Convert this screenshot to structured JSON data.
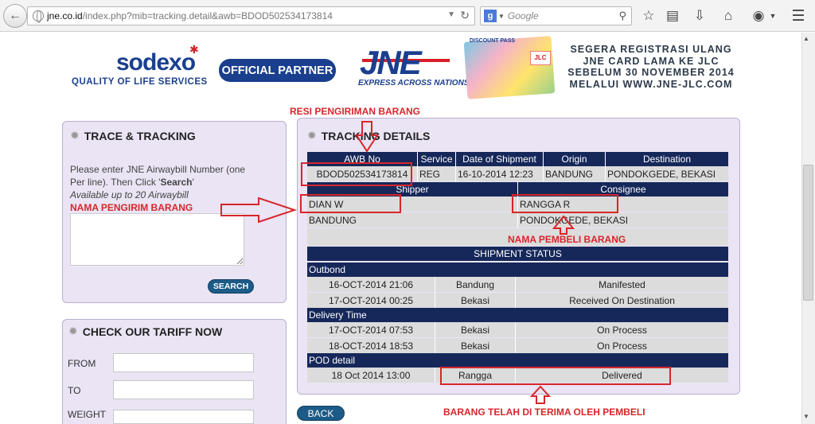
{
  "browser": {
    "url_host": "jne.co.id",
    "url_path": "/index.php?mib=tracking.detail&awb=BDOD502534173814",
    "search_placeholder": "Google",
    "search_engine_icon": "g"
  },
  "banner": {
    "sodexo": "sodexo",
    "sodexo_tagline": "QUALITY OF LIFE SERVICES",
    "official_partner": "OFFICIAL PARTNER",
    "jne_logo": "JNE",
    "jne_tagline": "EXPRESS ACROSS NATIONS",
    "card_label": "DISCOUNT PASS",
    "card_badge": "JLC",
    "promo_lines": [
      "SEGERA REGISTRASI ULANG",
      "JNE CARD LAMA KE JLC",
      "SEBELUM 30 NOVEMBER 2014",
      "MELALUI WWW.JNE-JLC.COM"
    ]
  },
  "trace": {
    "title": "TRACE & TRACKING",
    "help_line1": "Please enter JNE Airwaybill Number (one",
    "help_line2_pre": "Per line). Then Click '",
    "help_line2_bold": "Search",
    "help_line2_post": "'",
    "help_line3": "Available up to 20 Airwaybill",
    "search_button": "SEARCH"
  },
  "tariff": {
    "title": "CHECK OUR TARIFF NOW",
    "from_label": "FROM",
    "to_label": "TO",
    "weight_label": "WEIGHT"
  },
  "details": {
    "title": "TRACKING DETAILS",
    "headers": {
      "awb": "AWB No",
      "service": "Service",
      "date": "Date of Shipment",
      "origin": "Origin",
      "destination": "Destination"
    },
    "awb_no": "BDOD502534173814",
    "service": "REG",
    "date": "16-10-2014 12:23",
    "origin": "BANDUNG",
    "destination": "PONDOKGEDE, BEKASI",
    "shipper_header": "Shipper",
    "consignee_header": "Consignee",
    "shipper_name": "DIAN W",
    "shipper_city": "BANDUNG",
    "consignee_name": "RANGGA R",
    "consignee_city": "PONDOKGEDE, BEKASI",
    "status_header": "SHIPMENT STATUS",
    "outbond_label": "Outbond",
    "outbond_rows": [
      {
        "time": "16-OCT-2014 21:06",
        "city": "Bandung",
        "status": "Manifested"
      },
      {
        "time": "17-OCT-2014 00:25",
        "city": "Bekasi",
        "status": "Received On Destination"
      }
    ],
    "delivery_label": "Delivery Time",
    "delivery_rows": [
      {
        "time": "17-OCT-2014 07:53",
        "city": "Bekasi",
        "status": "On Process"
      },
      {
        "time": "18-OCT-2014 18:53",
        "city": "Bekasi",
        "status": "On Process"
      }
    ],
    "pod_label": "POD detail",
    "pod_row": {
      "time": "18 Oct 2014 13:00",
      "receiver": "Rangga",
      "status": "Delivered"
    },
    "back_button": "BACK"
  },
  "annotations": {
    "resi": "RESI PENGIRIMAN BARANG",
    "pengirim": "NAMA PENGIRIM BARANG",
    "pembeli": "NAMA PEMBELI BARANG",
    "diterima": "BARANG TELAH DI TERIMA OLEH PEMBELI"
  },
  "colors": {
    "header_navy": "#16285a",
    "panel_lavender": "#eae4f4",
    "annotation_red": "#d7262a",
    "button_blue": "#1c5b87"
  }
}
